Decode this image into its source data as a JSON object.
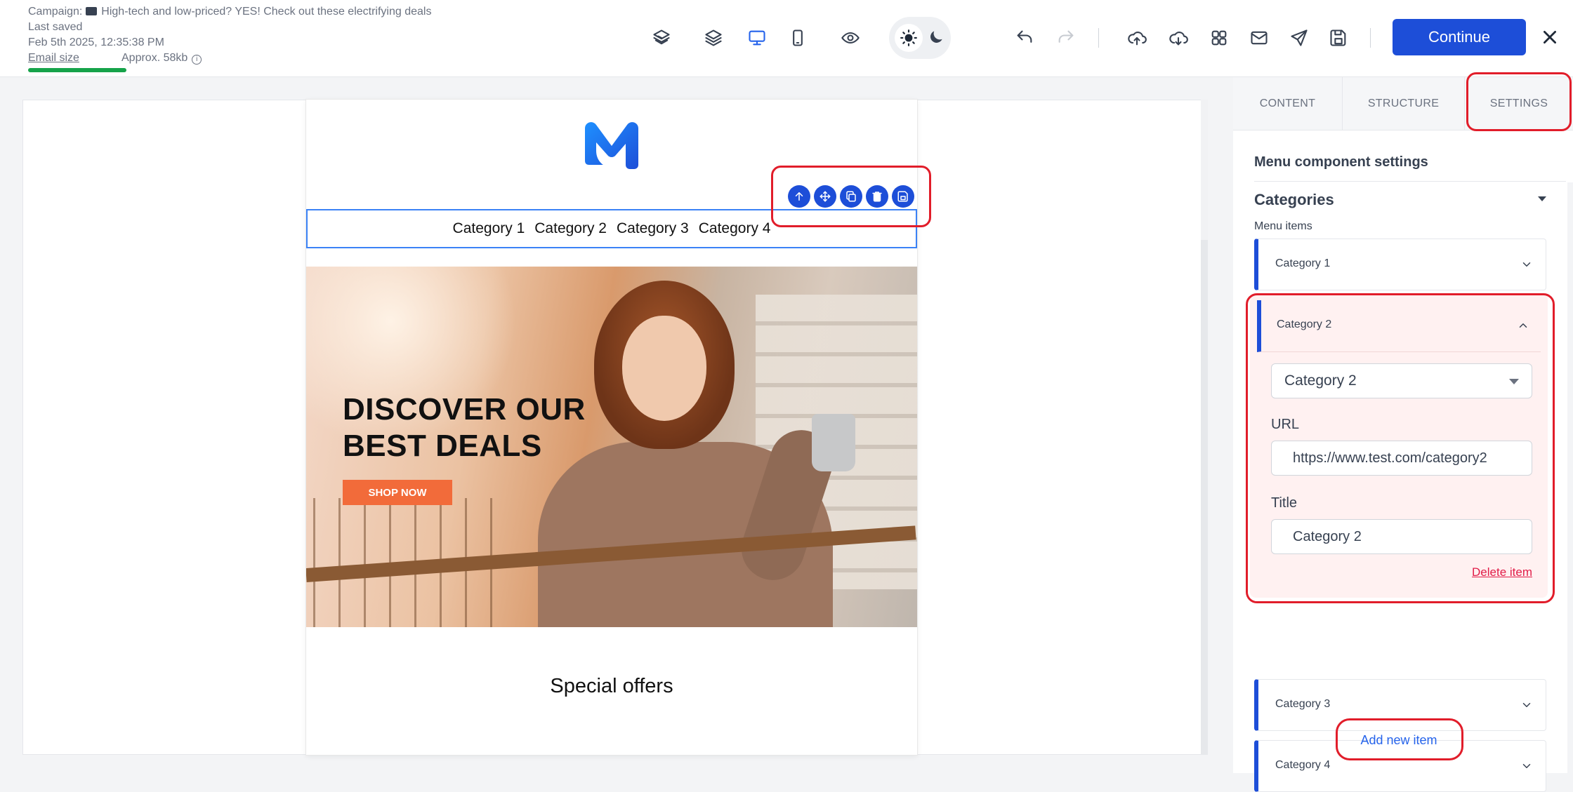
{
  "meta": {
    "campaign_prefix": "Campaign:",
    "campaign_title": "High-tech and low-priced? YES! Check out these electrifying deals",
    "last_saved_label": "Last saved",
    "last_saved_value": "Feb 5th 2025, 12:35:38 PM",
    "email_size_label": "Email size",
    "email_size_value": "Approx. 58kb",
    "info_glyph": "i"
  },
  "toolbar": {
    "icons": [
      "layers-icon",
      "stack-icon",
      "desktop-icon",
      "mobile-icon",
      "eye-icon",
      "sun-icon",
      "moon-icon",
      "undo-icon",
      "redo-icon",
      "upload-icon",
      "download-icon",
      "grid-icon",
      "mail-icon",
      "send-icon",
      "save-icon"
    ],
    "active_view": "desktop",
    "continue_label": "Continue"
  },
  "email": {
    "menu_items": [
      "Category 1",
      "Category 2",
      "Category 3",
      "Category 4"
    ],
    "hero_title_line1": "DISCOVER OUR",
    "hero_title_line2": "BEST DEALS",
    "shop_button": "SHOP NOW",
    "section_title": "Special offers",
    "block_tools": [
      "arrow-up-icon",
      "move-icon",
      "copy-icon",
      "trash-icon",
      "save-block-icon"
    ]
  },
  "panel": {
    "tabs": [
      "CONTENT",
      "STRUCTURE",
      "SETTINGS"
    ],
    "active_tab": "SETTINGS",
    "title": "Menu component settings",
    "section": "Categories",
    "items_label": "Menu items",
    "items": [
      {
        "label": "Category 1",
        "expanded": false
      },
      {
        "label": "Category 2",
        "expanded": true,
        "select_value": "Category 2",
        "url_label": "URL",
        "url_value": "https://www.test.com/category2",
        "title_label": "Title",
        "title_value": "Category 2",
        "delete_label": "Delete item"
      },
      {
        "label": "Category 3",
        "expanded": false
      },
      {
        "label": "Category 4",
        "expanded": false
      }
    ],
    "add_label": "Add new item"
  },
  "colors": {
    "accent": "#1d4ed8",
    "highlight": "#e11d2a",
    "size_bar": "#16a34a",
    "shop_button": "#f26b3a",
    "delete": "#e11d48"
  }
}
